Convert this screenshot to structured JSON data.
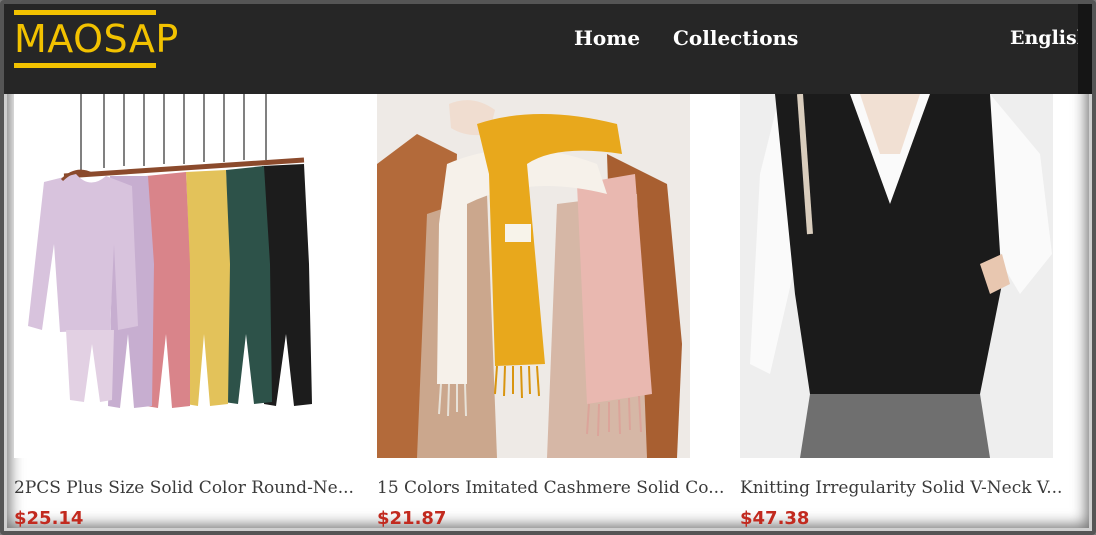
{
  "header": {
    "logo": "MAOSAP",
    "nav": {
      "home": "Home",
      "collections": "Collections"
    },
    "language": "English"
  },
  "products": [
    {
      "title": "2PCS Plus Size Solid Color Round-Ne...",
      "price": "$25.14"
    },
    {
      "title": "15 Colors Imitated Cashmere Solid Co...",
      "price": "$21.87"
    },
    {
      "title": "Knitting Irregularity Solid V-Neck V...",
      "price": "$47.38"
    }
  ],
  "colors": {
    "logo": "#f2c200",
    "header_bg": "#262626",
    "price": "#c22a1f"
  },
  "icons": {
    "language_dropdown": "chevron-down-icon"
  }
}
